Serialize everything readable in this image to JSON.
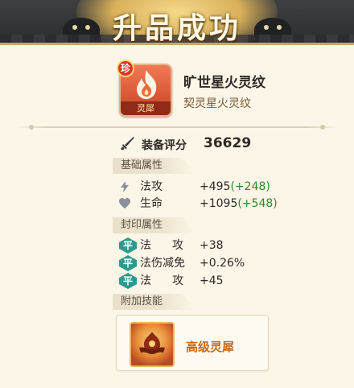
{
  "banner": {
    "title": "升品成功"
  },
  "item": {
    "badge": "珍",
    "icon_label": "灵犀",
    "name": "旷世星火灵纹",
    "subtitle": "契灵星火灵纹"
  },
  "score": {
    "label": "装备评分",
    "value": "36629"
  },
  "sections": {
    "base": "基础属性",
    "seal": "封印属性",
    "skill": "附加技能"
  },
  "base_stats": [
    {
      "name": "法攻",
      "value": "+495",
      "bonus": "(+248)",
      "icon": "lightning-icon"
    },
    {
      "name": "生命",
      "value": "+1095",
      "bonus": "(+548)",
      "icon": "heart-icon"
    }
  ],
  "seal_stats": [
    {
      "badge": "平",
      "name": "法攻",
      "value": "+38"
    },
    {
      "badge": "平",
      "name": "法伤减免",
      "value": "+0.26%"
    },
    {
      "badge": "平",
      "name": "法攻",
      "value": "+45"
    }
  ],
  "skill": {
    "name": "高级灵犀",
    "icon": "lingxi-skill-icon"
  },
  "colors": {
    "accent_gold": "#c9a864",
    "bonus_green": "#2f8a2a",
    "seal_teal": "#2c9a8e",
    "item_red": "#c94324",
    "skill_orange": "#c46a1d"
  }
}
